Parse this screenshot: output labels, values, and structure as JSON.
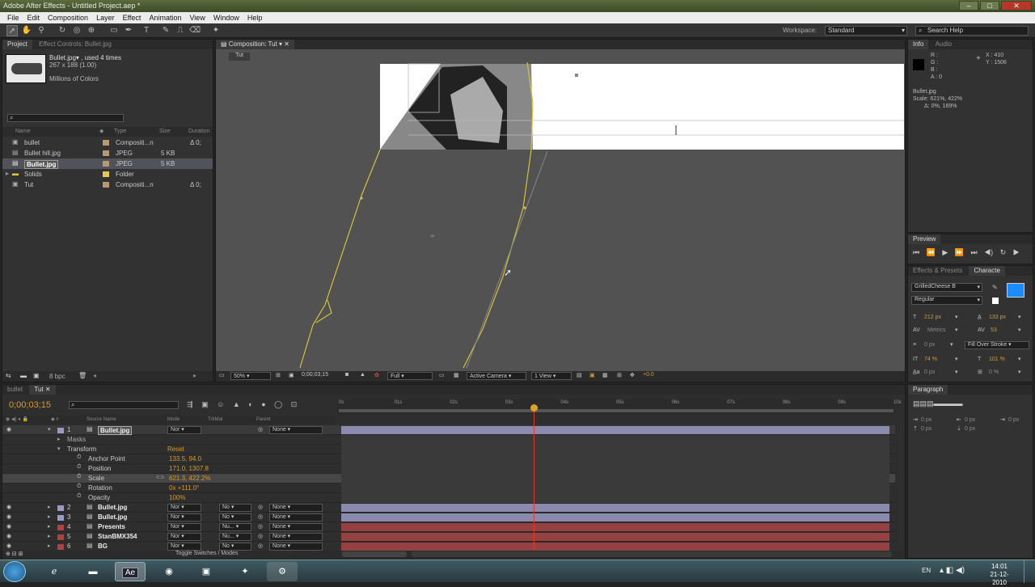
{
  "titlebar": {
    "title": "Adobe After Effects - Untitled Project.aep *"
  },
  "menu": [
    "File",
    "Edit",
    "Composition",
    "Layer",
    "Effect",
    "Animation",
    "View",
    "Window",
    "Help"
  ],
  "toolbar": {
    "workspace_label": "Workspace:",
    "workspace_value": "Standard",
    "search_placeholder": "Search Help"
  },
  "project": {
    "tabs": [
      "Project",
      "Effect Controls: Bullet.jpg"
    ],
    "preview_name": "Bullet.jpg▾ , used 4 times",
    "preview_dims": "267 x 188 (1.00)",
    "preview_colors": "Millions of Colors",
    "columns": [
      "Name",
      "Type",
      "Size",
      "Duration"
    ],
    "items": [
      {
        "name": "bullet",
        "type": "Compositi...n",
        "size": "",
        "dur": "Δ 0;",
        "color": "#b59b6f",
        "icon": "composition-icon"
      },
      {
        "name": "Bullet hill.jpg",
        "type": "JPEG",
        "size": "5 KB",
        "dur": "",
        "color": "#b59b6f",
        "icon": "image-icon"
      },
      {
        "name": "Bullet.jpg",
        "type": "JPEG",
        "size": "5 KB",
        "dur": "",
        "color": "#b59b6f",
        "icon": "image-icon",
        "selected": true
      },
      {
        "name": "Solids",
        "type": "Folder",
        "size": "",
        "dur": "",
        "color": "#e6c84a",
        "icon": "folder-icon"
      },
      {
        "name": "Tut",
        "type": "Compositi...n",
        "size": "",
        "dur": "Δ 0;",
        "color": "#b59b6f",
        "icon": "composition-icon"
      }
    ],
    "bpc": "8 bpc"
  },
  "composition": {
    "tab": "Composition: Tut",
    "subtab": "Tut",
    "zoom": "50%",
    "timecode": "0;00;03;15",
    "resolution": "Full",
    "camera": "Active Camera",
    "views": "1 View",
    "exposure": "+0.0"
  },
  "info": {
    "tabs": [
      "Info",
      "Audio"
    ],
    "r": "R :",
    "g": "G :",
    "b": "B :",
    "a": "A : 0",
    "x": "X : 410",
    "y": "Y : 1506",
    "layer": "Bullet.jpg",
    "scale": "Scale: 621%, 422%",
    "delta": "Δ: 0%, 169%"
  },
  "preview": {
    "tab": "Preview"
  },
  "character": {
    "tabs": [
      "Effects & Presets",
      "Characte"
    ],
    "font": "GrilledCheese B",
    "style": "Regular",
    "size": "212 px",
    "leading": "133 px",
    "kerning": "Metrics",
    "tracking": "53",
    "stroke": "0 px",
    "stroke_type": "Fill Over Stroke",
    "vscale": "74 %",
    "hscale": "101 %",
    "baseline": "0 px",
    "tsume": "0 %"
  },
  "paragraph": {
    "tab": "Paragraph",
    "indent1": "0 px",
    "indent2": "0 px",
    "indent3": "0 px",
    "space1": "0 px",
    "space2": "0 px"
  },
  "timeline": {
    "tabs": [
      "bullet",
      "Tut"
    ],
    "timecode": "0;00;03;15",
    "columns": {
      "source": "Source Name",
      "mode": "Mode",
      "trkmat": "TrkMat",
      "parent": "Parent"
    },
    "ruler": [
      "0s",
      "01s",
      "02s",
      "03s",
      "04s",
      "05s",
      "06s",
      "07s",
      "08s",
      "09s",
      "10s"
    ],
    "playhead": 0.352,
    "layers": [
      {
        "num": "1",
        "name": "Bullet.jpg",
        "mode": "Nor",
        "trk": "",
        "parent": "None",
        "color": "#9a9ac4",
        "selected": true
      },
      {
        "num": "2",
        "name": "Bullet.jpg",
        "mode": "Nor",
        "trk": "No",
        "parent": "None",
        "color": "#9a9ac4"
      },
      {
        "num": "3",
        "name": "Bullet.jpg",
        "mode": "Nor",
        "trk": "No",
        "parent": "None",
        "color": "#9a9ac4"
      },
      {
        "num": "4",
        "name": "Presents",
        "mode": "Nor",
        "trk": "Nu...",
        "parent": "None",
        "color": "#a84444"
      },
      {
        "num": "5",
        "name": "StanBMX354",
        "mode": "Nor",
        "trk": "Nu...",
        "parent": "None",
        "color": "#a84444"
      },
      {
        "num": "6",
        "name": "BG",
        "mode": "Nor",
        "trk": "No",
        "parent": "None",
        "color": "#a84444"
      }
    ],
    "masks": "Masks",
    "transform": "Transform",
    "reset": "Reset",
    "props": [
      {
        "name": "Anchor Point",
        "value": "133.5, 94.0"
      },
      {
        "name": "Position",
        "value": "171.0, 1307.8"
      },
      {
        "name": "Scale",
        "value": "621.3, 422.2%"
      },
      {
        "name": "Rotation",
        "value": "0x +111.0°"
      },
      {
        "name": "Opacity",
        "value": "100%"
      }
    ],
    "toggle": "Toggle Switches / Modes"
  },
  "taskbar": {
    "lang": "EN",
    "time": "14:01",
    "date": "21-12-2010",
    "ae_label": "Ae"
  }
}
